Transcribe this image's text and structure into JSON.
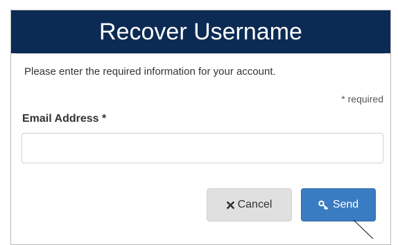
{
  "dialog": {
    "title": "Recover Username",
    "intro": "Please enter the required information for your account.",
    "required_note": "* required",
    "email": {
      "label": "Email Address *",
      "value": "",
      "placeholder": ""
    },
    "buttons": {
      "cancel": {
        "label": "Cancel",
        "icon": "close-icon"
      },
      "send": {
        "label": "Send",
        "icon": "key-icon"
      }
    }
  },
  "colors": {
    "header_bg": "#0c2b54",
    "send_bg": "#3a7cc2",
    "cancel_bg": "#e0e0e0"
  }
}
